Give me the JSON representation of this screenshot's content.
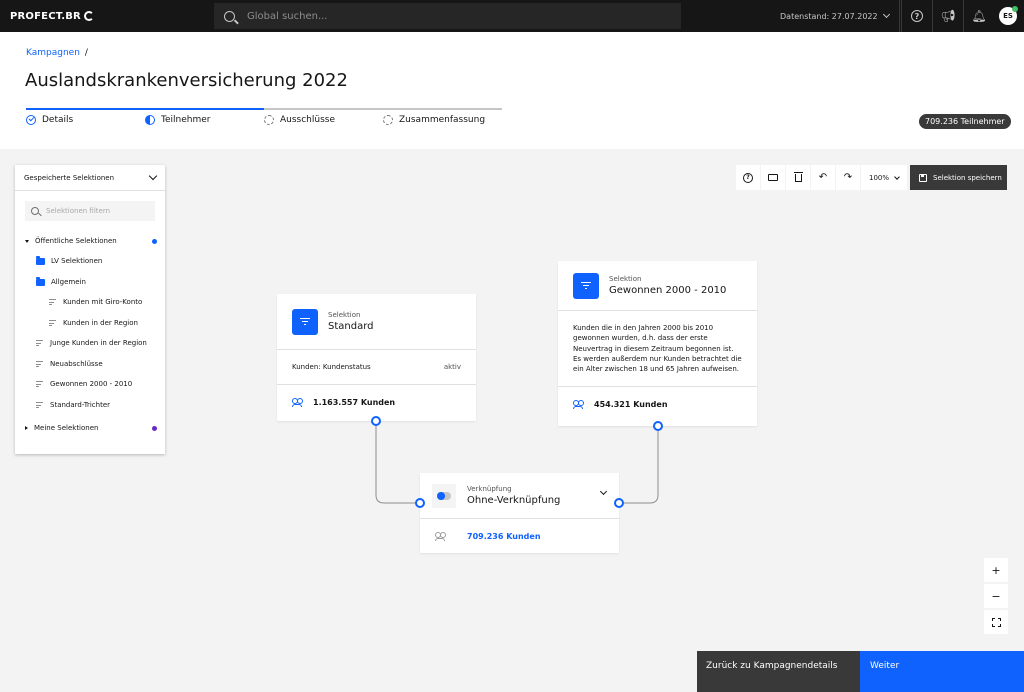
{
  "header": {
    "logo": "PROFECT.BR",
    "search_placeholder": "Global suchen...",
    "datenstand": "Datenstand: 27.07.2022",
    "avatar_initials": "ES"
  },
  "breadcrumb": {
    "link": "Kampagnen",
    "separator": "/"
  },
  "page_title": "Auslandskrankenversicherung 2022",
  "steps": [
    {
      "label": "Details",
      "state": "done"
    },
    {
      "label": "Teilnehmer",
      "state": "current"
    },
    {
      "label": "Ausschlüsse",
      "state": "todo"
    },
    {
      "label": "Zusammenfassung",
      "state": "todo"
    }
  ],
  "participants_badge": "709.236 Teilnehmer",
  "sidebar": {
    "title": "Gespeicherte Selektionen",
    "filter_placeholder": "Selektionen filtern",
    "items": [
      {
        "label": "Öffentliche Selektionen",
        "kind": "group-open",
        "dot": "#0f62fe"
      },
      {
        "label": "LV Selektionen",
        "kind": "folder"
      },
      {
        "label": "Allgemein",
        "kind": "folder"
      },
      {
        "label": "Kunden mit Giro-Konto",
        "kind": "selection"
      },
      {
        "label": "Kunden in der Region",
        "kind": "selection"
      },
      {
        "label": "Junge Kunden in der Region",
        "kind": "selection"
      },
      {
        "label": "Neuabschlüsse",
        "kind": "selection"
      },
      {
        "label": "Gewonnen 2000 - 2010",
        "kind": "selection"
      },
      {
        "label": "Standard-Trichter",
        "kind": "selection"
      },
      {
        "label": "Meine Selektionen",
        "kind": "group-closed",
        "dot": "#6929c4"
      }
    ]
  },
  "toolbar": {
    "zoom": "100%",
    "save_label": "Selektion speichern"
  },
  "nodes": {
    "standard": {
      "kind": "Selektion",
      "title": "Standard",
      "attr_label": "Kunden: Kundenstatus",
      "attr_value": "aktiv",
      "count": "1.163.557 Kunden"
    },
    "gewonnen": {
      "kind": "Selektion",
      "title": "Gewonnen 2000 - 2010",
      "description": "Kunden die in den Jahren 2000 bis 2010 gewonnen wurden, d.h. dass der erste Neuvertrag in diesem Zeitraum begonnen ist. Es werden außerdem nur Kunden betrachtet die ein Alter zwischen 18 und 65 Jahren aufweisen.",
      "count": "454.321 Kunden"
    },
    "verknuepfung": {
      "kind": "Verknüpfung",
      "title": "Ohne-Verknüpfung",
      "count": "709.236 Kunden"
    }
  },
  "zoom_controls": {
    "plus": "+",
    "minus": "−"
  },
  "footer": {
    "back_label": "Zurück zu Kampagnendetails",
    "next_label": "Weiter"
  },
  "colors": {
    "accent": "#0f62fe",
    "dark": "#161616",
    "panel_dark": "#393939"
  }
}
